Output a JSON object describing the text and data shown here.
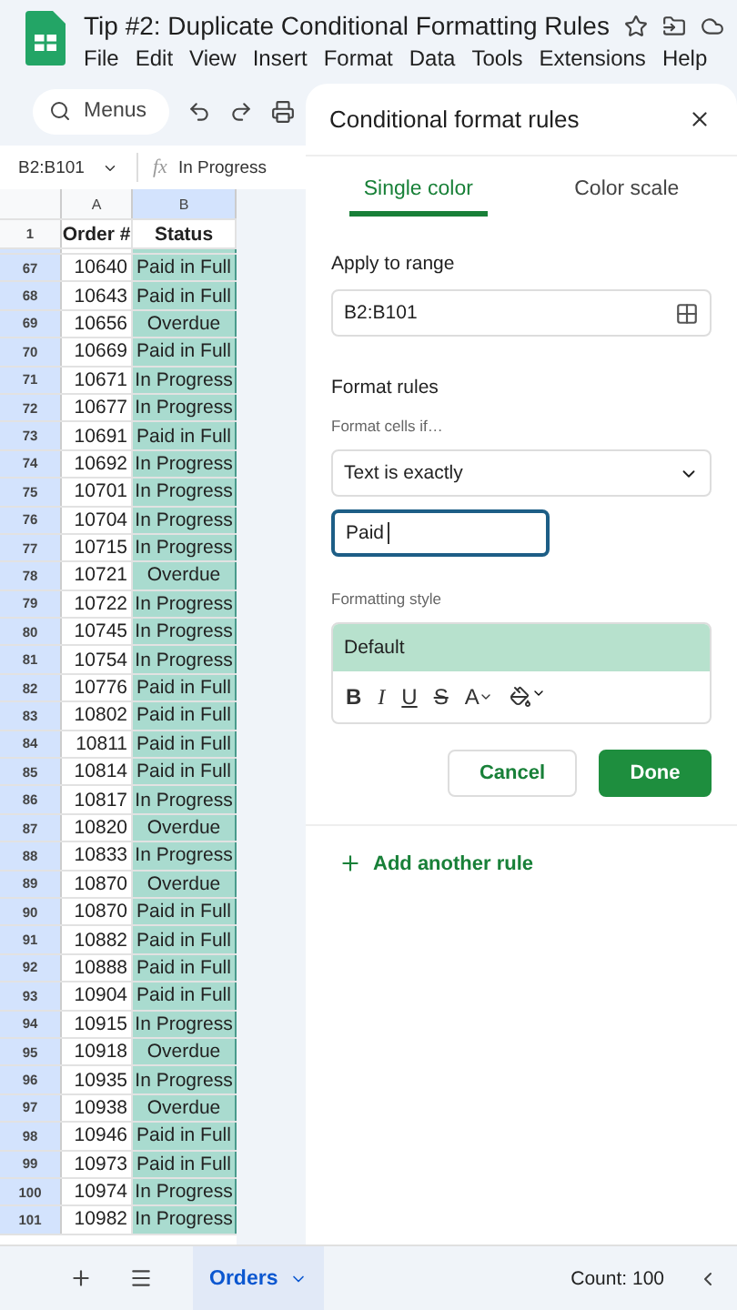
{
  "document": {
    "title": "Tip #2: Duplicate Conditional Formatting Rules"
  },
  "menu": [
    "File",
    "Edit",
    "View",
    "Insert",
    "Format",
    "Data",
    "Tools",
    "Extensions",
    "Help"
  ],
  "toolbar": {
    "search_placeholder": "Menus"
  },
  "formula_bar": {
    "name_box": "B2:B101",
    "fx": "fx",
    "value": "In Progress"
  },
  "sheet": {
    "columns": [
      {
        "label": "A",
        "selected": false
      },
      {
        "label": "B",
        "selected": true
      }
    ],
    "header_row": {
      "number": "1",
      "cells": [
        "Order #",
        "Status"
      ]
    },
    "rows": [
      {
        "number": "67",
        "order": "10640",
        "status": "Paid in Full"
      },
      {
        "number": "68",
        "order": "10643",
        "status": "Paid in Full"
      },
      {
        "number": "69",
        "order": "10656",
        "status": "Overdue"
      },
      {
        "number": "70",
        "order": "10669",
        "status": "Paid in Full"
      },
      {
        "number": "71",
        "order": "10671",
        "status": "In Progress"
      },
      {
        "number": "72",
        "order": "10677",
        "status": "In Progress"
      },
      {
        "number": "73",
        "order": "10691",
        "status": "Paid in Full"
      },
      {
        "number": "74",
        "order": "10692",
        "status": "In Progress"
      },
      {
        "number": "75",
        "order": "10701",
        "status": "In Progress"
      },
      {
        "number": "76",
        "order": "10704",
        "status": "In Progress"
      },
      {
        "number": "77",
        "order": "10715",
        "status": "In Progress"
      },
      {
        "number": "78",
        "order": "10721",
        "status": "Overdue"
      },
      {
        "number": "79",
        "order": "10722",
        "status": "In Progress"
      },
      {
        "number": "80",
        "order": "10745",
        "status": "In Progress"
      },
      {
        "number": "81",
        "order": "10754",
        "status": "In Progress"
      },
      {
        "number": "82",
        "order": "10776",
        "status": "Paid in Full"
      },
      {
        "number": "83",
        "order": "10802",
        "status": "Paid in Full"
      },
      {
        "number": "84",
        "order": "10811",
        "status": "Paid in Full"
      },
      {
        "number": "85",
        "order": "10814",
        "status": "Paid in Full"
      },
      {
        "number": "86",
        "order": "10817",
        "status": "In Progress"
      },
      {
        "number": "87",
        "order": "10820",
        "status": "Overdue"
      },
      {
        "number": "88",
        "order": "10833",
        "status": "In Progress"
      },
      {
        "number": "89",
        "order": "10870",
        "status": "Overdue"
      },
      {
        "number": "90",
        "order": "10870",
        "status": "Paid in Full"
      },
      {
        "number": "91",
        "order": "10882",
        "status": "Paid in Full"
      },
      {
        "number": "92",
        "order": "10888",
        "status": "Paid in Full"
      },
      {
        "number": "93",
        "order": "10904",
        "status": "Paid in Full"
      },
      {
        "number": "94",
        "order": "10915",
        "status": "In Progress"
      },
      {
        "number": "95",
        "order": "10918",
        "status": "Overdue"
      },
      {
        "number": "96",
        "order": "10935",
        "status": "In Progress"
      },
      {
        "number": "97",
        "order": "10938",
        "status": "Overdue"
      },
      {
        "number": "98",
        "order": "10946",
        "status": "Paid in Full"
      },
      {
        "number": "99",
        "order": "10973",
        "status": "Paid in Full"
      },
      {
        "number": "100",
        "order": "10974",
        "status": "In Progress"
      },
      {
        "number": "101",
        "order": "10982",
        "status": "In Progress"
      }
    ]
  },
  "panel": {
    "title": "Conditional format rules",
    "tabs": [
      {
        "label": "Single color",
        "selected": true
      },
      {
        "label": "Color scale",
        "selected": false
      }
    ],
    "apply_label": "Apply to range",
    "range": "B2:B101",
    "rules_heading": "Format rules",
    "condition_label": "Format cells if…",
    "condition": "Text is exactly",
    "value": "Paid",
    "style_label": "Formatting style",
    "style_preview": "Default",
    "style_buttons": [
      {
        "label": "B",
        "kind": "bold"
      },
      {
        "label": "I",
        "kind": "italic"
      },
      {
        "label": "U",
        "kind": "underline"
      },
      {
        "label": "S",
        "kind": "strike"
      },
      {
        "label": "A",
        "kind": "text-color"
      }
    ],
    "buttons": [
      {
        "label": "Cancel",
        "kind": "secondary"
      },
      {
        "label": "Done",
        "kind": "primary"
      }
    ],
    "add_rule": "Add another rule"
  },
  "footer": {
    "sheet_tabs": [
      {
        "label": "Orders",
        "selected": true
      }
    ],
    "count": "Count: 100"
  }
}
